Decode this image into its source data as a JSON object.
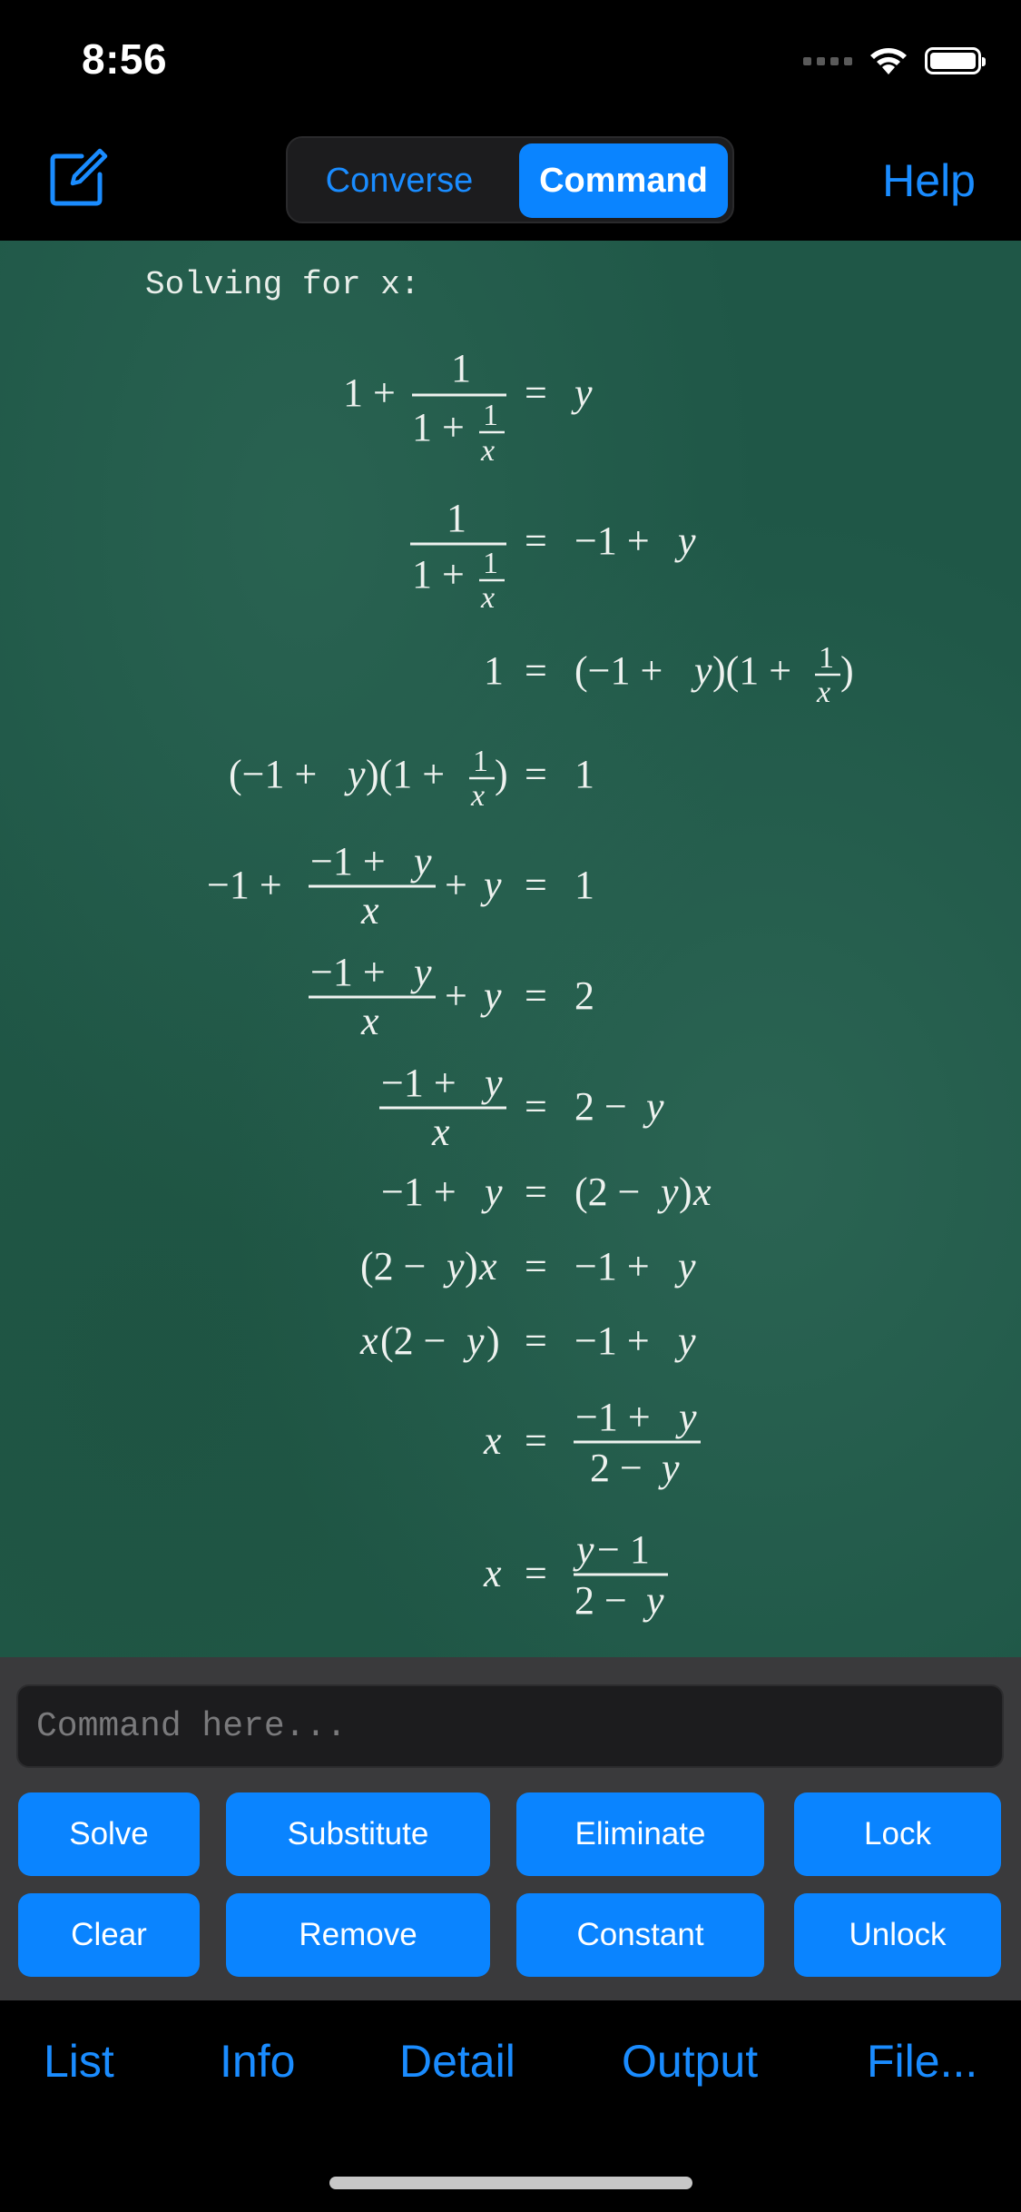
{
  "status": {
    "time": "8:56"
  },
  "nav": {
    "segments": [
      "Converse",
      "Command"
    ],
    "selected": "Command",
    "help_label": "Help"
  },
  "board": {
    "heading": "Solving for x:",
    "steps": [
      "1 + 1/(1 + 1/x) = y",
      "1/(1 + 1/x) = −1 + y",
      "1 = (−1 + y)(1 + 1/x)",
      "(−1 + y)(1 + 1/x) = 1",
      "−1 + (−1 + y)/x + y = 1",
      "(−1 + y)/x + y = 2",
      "(−1 + y)/x = 2 − y",
      "−1 + y = (2 − y)x",
      "(2 − y)x = −1 + y",
      "x(2 − y) = −1 + y",
      "x = (−1 + y)/(2 − y)",
      "x = (y − 1)/(2 − y)"
    ]
  },
  "input": {
    "placeholder": "Command here..."
  },
  "buttons": {
    "row1": [
      "Solve",
      "Substitute",
      "Eliminate",
      "Lock"
    ],
    "row2": [
      "Clear",
      "Remove",
      "Constant",
      "Unlock"
    ]
  },
  "tabs": [
    "List",
    "Info",
    "Detail",
    "Output",
    "File..."
  ],
  "colors": {
    "accent": "#0a84ff",
    "board": "#1f5747",
    "panel": "#3a3a3c"
  },
  "icons": [
    "wifi-icon",
    "battery-icon",
    "signal-icon",
    "compose-icon"
  ]
}
